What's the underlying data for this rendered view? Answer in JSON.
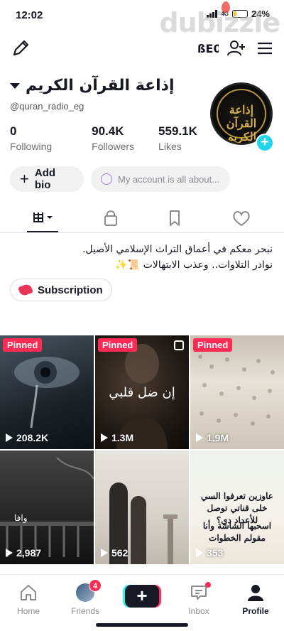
{
  "status_bar": {
    "time": "12:02",
    "battery": "24%",
    "network": "4G",
    "battery_level": 0.24
  },
  "watermark": {
    "text": "dubizzle"
  },
  "profile": {
    "display_name": "إذاعة القرآن الكريم",
    "handle": "@quran_radio_eg",
    "avatar_text": "إذاعة القرآن الكريم",
    "stats": [
      {
        "value": "0",
        "label": "Following"
      },
      {
        "value": "90.4K",
        "label": "Followers"
      },
      {
        "value": "559.1K",
        "label": "Likes"
      }
    ],
    "add_bio_label": "Add bio",
    "account_placeholder": "My account is all about...",
    "bio_line1": "نبحر معكم في أعماق التراث الإسلامي الأصيل.",
    "bio_line2": "نوادر التلاوات.. وعذب الابتهالات 📜✨",
    "subscription_label": "Subscription"
  },
  "videos": [
    {
      "views": "208.2K",
      "pinned": "Pinned",
      "overlay": ""
    },
    {
      "views": "1.3M",
      "pinned": "Pinned",
      "overlay": "إن ضل قلبي"
    },
    {
      "views": "1.9M",
      "pinned": "Pinned",
      "overlay": ""
    },
    {
      "views": "2,987",
      "pinned": "",
      "overlay": "وافا"
    },
    {
      "views": "562",
      "pinned": "",
      "overlay": ""
    },
    {
      "views": "353",
      "pinned": "",
      "overlay": "عاوزين تعرفوا السي خلى قناتي توصل للأعداد دي؟"
    }
  ],
  "video6_line2": "اسحبها الشاشة وأنا مقولم الخطوات",
  "nav": {
    "home": "Home",
    "friends": "Friends",
    "friends_badge": "4",
    "inbox": "Inbox",
    "profile": "Profile"
  },
  "colors": {
    "accent": "#fe2c55",
    "cyan": "#20d5ec",
    "text": "#161823"
  },
  "icons": [
    "edit-icon",
    "creator-tools-icon",
    "add-friend-icon",
    "menu-icon",
    "grid-icon",
    "lock-icon",
    "bookmark-icon",
    "heart-icon",
    "home-icon",
    "inbox-icon",
    "profile-icon"
  ]
}
